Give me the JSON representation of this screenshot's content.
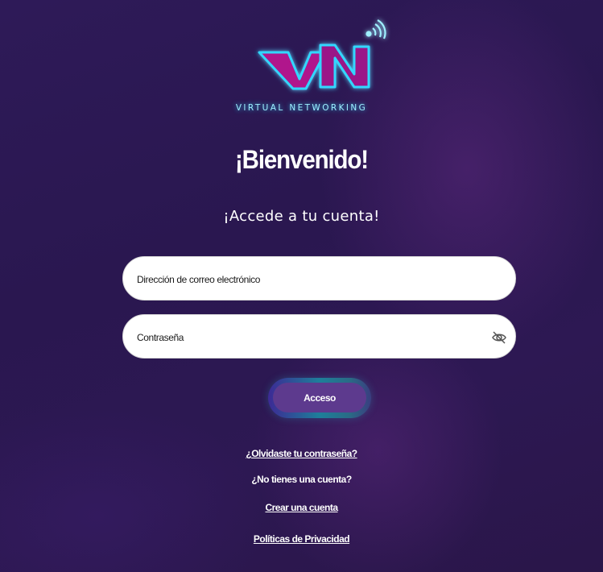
{
  "brand": {
    "logo_text": "VN",
    "tagline": "VIRTUAL NETWORKING"
  },
  "header": {
    "title": "¡Bienvenido!",
    "subtitle": "¡Accede a tu cuenta!"
  },
  "form": {
    "email_placeholder": "Dirección de correo electrónico",
    "password_placeholder": "Contraseña",
    "submit_label": "Acceso"
  },
  "links": {
    "forgot_password": "¿Olvidaste tu contraseña?",
    "no_account": "¿No tienes una cuenta?",
    "create_account": "Crear una cuenta",
    "privacy": "Políticas de Privacidad"
  },
  "colors": {
    "accent_cyan": "#2ad4ff",
    "logo_magenta": "#b0148c",
    "button": "#5d3a8e"
  },
  "icons": {
    "password_toggle": "eye-slash-icon",
    "logo_signal": "wifi-signal-icon"
  }
}
